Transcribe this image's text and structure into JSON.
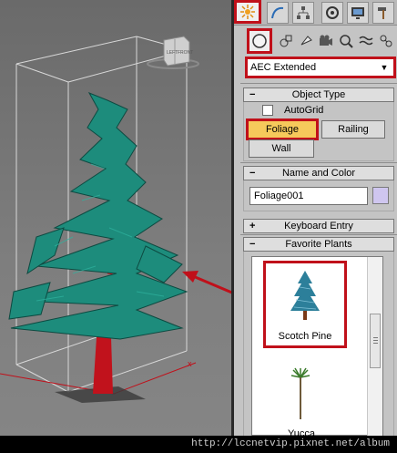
{
  "colors": {
    "accent_red": "#c0101a",
    "foliage_button": "#f6c95b",
    "swatch": "#cfc6ef",
    "tree_foliage": "#1d8c7c",
    "tree_trunk": "#c1121c"
  },
  "viewcube": {
    "left_label": "LEFT",
    "front_label": "FRONT"
  },
  "command_tabs": [
    {
      "name": "create-tab",
      "icon": "sun-star-icon",
      "active": true
    },
    {
      "name": "modify-tab",
      "icon": "curve-modify-icon",
      "active": false
    },
    {
      "name": "hierarchy-tab",
      "icon": "hierarchy-icon",
      "active": false
    },
    {
      "name": "motion-tab",
      "icon": "motion-circle-icon",
      "active": false
    },
    {
      "name": "display-tab",
      "icon": "display-monitor-icon",
      "active": false
    },
    {
      "name": "utilities-tab",
      "icon": "hammer-icon",
      "active": false
    }
  ],
  "category_buttons": [
    {
      "name": "geometry",
      "icon": "sphere-icon",
      "active": true
    },
    {
      "name": "shapes",
      "icon": "shapes-icon",
      "active": false
    },
    {
      "name": "lights",
      "icon": "light-icon",
      "active": false
    },
    {
      "name": "cameras",
      "icon": "camera-icon",
      "active": false
    },
    {
      "name": "helpers",
      "icon": "helper-icon",
      "active": false
    },
    {
      "name": "space-warps",
      "icon": "wave-icon",
      "active": false
    },
    {
      "name": "systems",
      "icon": "systems-icon",
      "active": false
    }
  ],
  "dropdown": {
    "value": "AEC Extended"
  },
  "object_type": {
    "title": "Object Type",
    "autogrid": "AutoGrid",
    "buttons": [
      "Foliage",
      "Railing",
      "Wall"
    ]
  },
  "name_color": {
    "title": "Name and Color",
    "name_value": "Foliage001"
  },
  "keyboard_entry": {
    "title": "Keyboard Entry"
  },
  "favorite_plants": {
    "title": "Favorite Plants",
    "items": [
      "Scotch Pine",
      "Yucca"
    ]
  },
  "watermark": "http://lccnetvip.pixnet.net/album"
}
